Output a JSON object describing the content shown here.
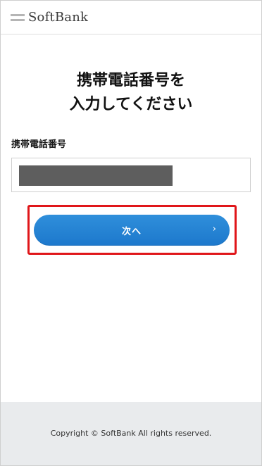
{
  "header": {
    "logo_text": "SoftBank"
  },
  "main": {
    "title_line1": "携帯電話番号を",
    "title_line2": "入力してください",
    "field_label": "携帯電話番号",
    "next_button_label": "次へ",
    "next_chevron": "›"
  },
  "footer": {
    "copyright": "Copyright © SoftBank All rights reserved."
  },
  "colors": {
    "button_blue": "#1d78cc",
    "highlight_red": "#e0161a",
    "footer_gray": "#e9ebed"
  }
}
